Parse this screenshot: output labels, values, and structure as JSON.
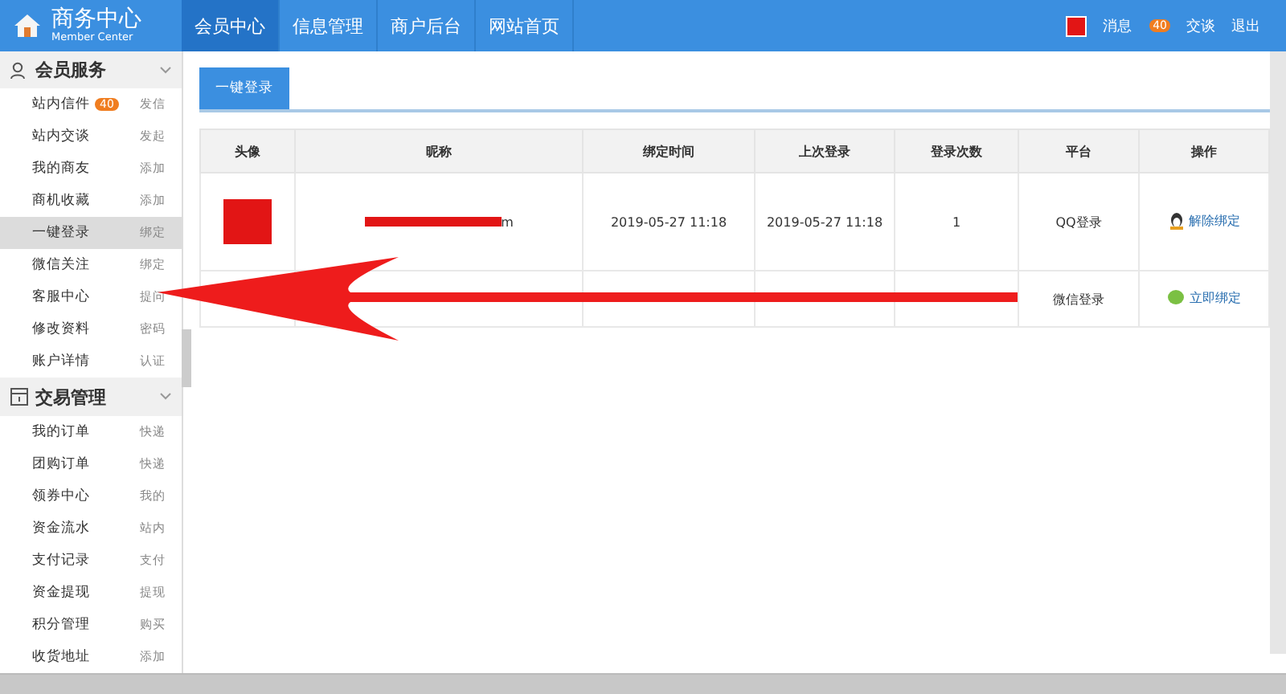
{
  "header": {
    "logo_title": "商务中心",
    "logo_subtitle": "Member Center",
    "nav": [
      {
        "label": "会员中心",
        "selected": true
      },
      {
        "label": "信息管理",
        "selected": false
      },
      {
        "label": "商户后台",
        "selected": false
      },
      {
        "label": "网站首页",
        "selected": false
      }
    ],
    "user_links": [
      {
        "label": "消息",
        "badge": "40"
      },
      {
        "label": "交谈"
      },
      {
        "label": "退出"
      }
    ]
  },
  "sidebar": {
    "sections": [
      {
        "title": "会员服务",
        "kind": "user",
        "expanded": true,
        "items": [
          {
            "label": "站内信件",
            "badge": "40",
            "action": "发信",
            "selected": false
          },
          {
            "label": "站内交谈",
            "action": "发起",
            "selected": false
          },
          {
            "label": "我的商友",
            "action": "添加",
            "selected": false
          },
          {
            "label": "商机收藏",
            "action": "添加",
            "selected": false
          },
          {
            "label": "一键登录",
            "action": "绑定",
            "selected": true
          },
          {
            "label": "微信关注",
            "action": "绑定",
            "selected": false
          },
          {
            "label": "客服中心",
            "action": "提问",
            "selected": false
          },
          {
            "label": "修改资料",
            "action": "密码",
            "selected": false
          },
          {
            "label": "账户详情",
            "action": "认证",
            "selected": false
          }
        ]
      },
      {
        "title": "交易管理",
        "kind": "trade",
        "expanded": true,
        "items": [
          {
            "label": "我的订单",
            "action": "快递",
            "selected": false
          },
          {
            "label": "团购订单",
            "action": "快递",
            "selected": false
          },
          {
            "label": "领券中心",
            "action": "我的",
            "selected": false
          },
          {
            "label": "资金流水",
            "action": "站内",
            "selected": false
          },
          {
            "label": "支付记录",
            "action": "支付",
            "selected": false
          },
          {
            "label": "资金提现",
            "action": "提现",
            "selected": false
          },
          {
            "label": "积分管理",
            "action": "购买",
            "selected": false
          },
          {
            "label": "收货地址",
            "action": "添加",
            "selected": false
          }
        ]
      }
    ]
  },
  "content": {
    "tabs": [
      {
        "label": "一键登录",
        "selected": true
      }
    ],
    "table": {
      "columns": [
        "头像",
        "昵称",
        "绑定时间",
        "上次登录",
        "登录次数",
        "平台",
        "操作"
      ],
      "rows": [
        {
          "avatar": true,
          "nickname": "m",
          "nickname_redacted": true,
          "bind_time": "2019-05-27 11:18",
          "last_login": "2019-05-27 11:18",
          "count": "1",
          "platform": "QQ登录",
          "kind": "qq",
          "action": "解除绑定"
        },
        {
          "avatar": false,
          "nickname_redacted": false,
          "platform": "微信登录",
          "kind": "wechat",
          "action": "立即绑定"
        }
      ]
    }
  }
}
